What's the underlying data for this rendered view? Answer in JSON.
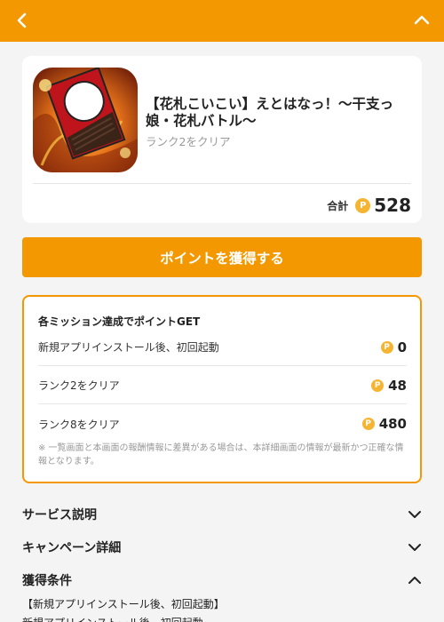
{
  "topbar": {
    "back_icon": "chevron-left-icon",
    "collapse_icon": "chevron-up-icon",
    "bg_color": "#f39800"
  },
  "app": {
    "title": "【花札こいこい】えとはなっ！〜干支っ娘・花札バトル〜",
    "subtitle": "ランク2をクリア",
    "total_label": "合計",
    "total_value": "528",
    "coin_symbol": "P"
  },
  "get_button": {
    "label": "ポイントを獲得する"
  },
  "missions": {
    "heading": "各ミッション達成でポイントGET",
    "rows": [
      {
        "label": "新規アプリインストール後、初回起動",
        "points": "0"
      },
      {
        "label": "ランク2をクリア",
        "points": "48"
      },
      {
        "label": "ランク8をクリア",
        "points": "480"
      }
    ],
    "note": "※ 一覧画面と本画面の報酬情報に差異がある場合は、本詳細画面の情報が最新かつ正確な情報となります。"
  },
  "sections": [
    {
      "title": "サービス説明",
      "icon": "chevron-down-icon"
    },
    {
      "title": "キャンペーン詳細",
      "icon": "chevron-down-icon"
    },
    {
      "title": "獲得条件",
      "icon": "chevron-up-icon"
    }
  ],
  "conditions": {
    "line1": "【新規アプリインストール後、初回起動】",
    "line2": "新規アプリインストール後、初回起動"
  },
  "colors": {
    "accent": "#f39800",
    "coin": "#f5b532"
  }
}
